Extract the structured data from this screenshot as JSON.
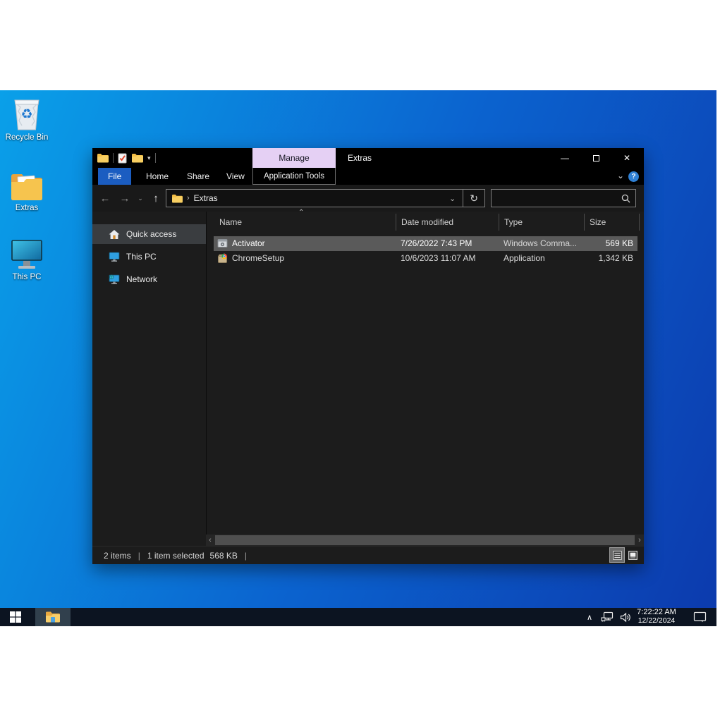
{
  "glyphs": {
    "minimize": "—",
    "close": "✕",
    "collapse_ribbon": "⌄",
    "help": "?",
    "back": "←",
    "forward": "→",
    "recent_chevron": "⌄",
    "up": "↑",
    "crumb_separator": "›",
    "address_dropdown": "⌄",
    "refresh": "↻",
    "scroll_left": "‹",
    "scroll_right": "›",
    "sort_ascending": "⌃",
    "qat_dropdown": "▾",
    "tray_expand": "∧"
  },
  "colors": {
    "desktop_gradient": [
      "#0aa0e9",
      "#0b63cf",
      "#0c3aad"
    ],
    "file_tab_blue": "#1b5dc1",
    "manage_tab_purple": "#e5d0f4",
    "selected_row_gray": "#5a5a5a",
    "taskbar_navy": "#0c1421",
    "window_bg": "#1c1c1c",
    "titlebar_black": "#000000",
    "sidebar_selected": "#3a3d40",
    "help_circle_blue": "#2f80d4"
  },
  "desktop": {
    "icons": [
      {
        "label": "Recycle Bin",
        "icon": "recycle-bin-icon"
      },
      {
        "label": "Extras",
        "icon": "folder-icon"
      },
      {
        "label": "This PC",
        "icon": "computer-icon"
      }
    ]
  },
  "explorer": {
    "title": "Extras",
    "qat_icons": [
      "folder-icon",
      "properties-check-icon",
      "folder-icon",
      "dropdown-chevron-icon"
    ],
    "contextual_group": "Manage",
    "ribbon_tabs": [
      {
        "label": "File",
        "active": true
      },
      {
        "label": "Home"
      },
      {
        "label": "Share"
      },
      {
        "label": "View"
      },
      {
        "label": "Application Tools",
        "contextual": true
      }
    ],
    "address": {
      "path": "Extras"
    },
    "search": {
      "value": "",
      "placeholder": ""
    },
    "sidebar": [
      {
        "label": "Quick access",
        "icon": "house-icon",
        "selected": true
      },
      {
        "label": "This PC",
        "icon": "monitor-icon",
        "selected": false
      },
      {
        "label": "Network",
        "icon": "network-icon",
        "selected": false
      }
    ],
    "file_list": {
      "columns": [
        {
          "label": "Name"
        },
        {
          "label": "Date modified"
        },
        {
          "label": "Type"
        },
        {
          "label": "Size"
        }
      ],
      "rows": [
        {
          "name": "Activator",
          "date_modified": "7/26/2022 7:43 PM",
          "type": "Windows Comma...",
          "size": "569 KB",
          "icon": "command-file-icon",
          "selected": true
        },
        {
          "name": "ChromeSetup",
          "date_modified": "10/6/2023 11:07 AM",
          "type": "Application",
          "size": "1,342 KB",
          "icon": "installer-file-icon",
          "selected": false
        }
      ]
    },
    "status_bar": {
      "items_count": "2 items",
      "divider": "|",
      "selection": "1 item selected",
      "selection_size": "568 KB"
    }
  },
  "taskbar": {
    "clock": {
      "time": "7:22:22 AM",
      "date": "12/22/2024"
    }
  }
}
